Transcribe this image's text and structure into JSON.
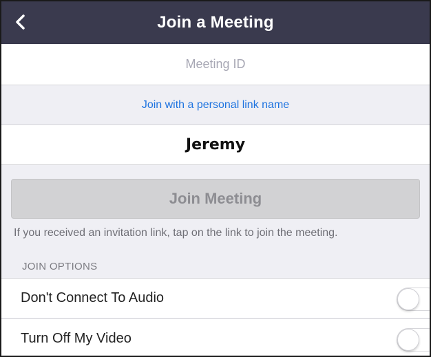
{
  "header": {
    "title": "Join a Meeting",
    "back_icon": "chevron-left-icon"
  },
  "meeting_id": {
    "value": "",
    "placeholder": "Meeting ID"
  },
  "personal_link": {
    "label": "Join with a personal link name"
  },
  "name": {
    "value": "Jeremy"
  },
  "join_button": {
    "label": "Join Meeting"
  },
  "hint": "If you received an invitation link, tap on the link to join the meeting.",
  "join_options": {
    "header": "JOIN OPTIONS",
    "items": [
      {
        "label": "Don't Connect To Audio",
        "enabled": false
      },
      {
        "label": "Turn Off My Video",
        "enabled": false
      }
    ]
  },
  "colors": {
    "header_bg": "#3a3a4e",
    "link": "#1f74e0",
    "page_bg": "#efeff4",
    "disabled_button": "#d2d2d4"
  }
}
